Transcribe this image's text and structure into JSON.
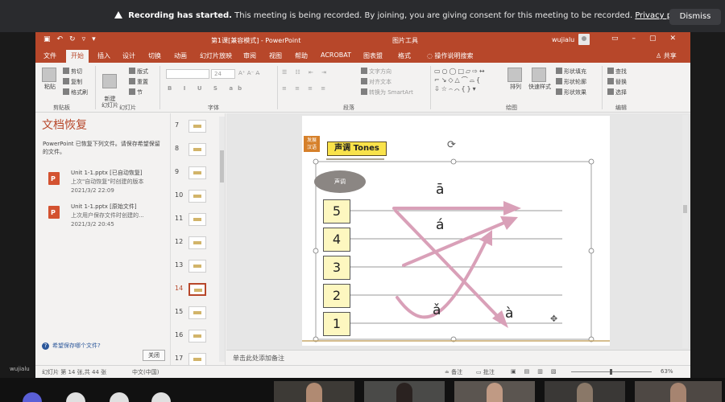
{
  "banner": {
    "title": "Recording has started.",
    "message": "This meeting is being recorded. By joining, you are giving consent for this meeting to be recorded.",
    "link": "Privacy policy",
    "dismiss": "Dismiss"
  },
  "window": {
    "title": "第1课[兼容模式] - PowerPoint",
    "context_tab": "图片工具",
    "user": "wujialu"
  },
  "tabs": [
    {
      "label": "文件"
    },
    {
      "label": "开始"
    },
    {
      "label": "插入"
    },
    {
      "label": "设计"
    },
    {
      "label": "切换"
    },
    {
      "label": "动画"
    },
    {
      "label": "幻灯片放映"
    },
    {
      "label": "审阅"
    },
    {
      "label": "视图"
    },
    {
      "label": "帮助"
    },
    {
      "label": "ACROBAT"
    },
    {
      "label": "图表盟"
    },
    {
      "label": "格式"
    },
    {
      "label": "操作说明搜索"
    },
    {
      "label": "共享"
    }
  ],
  "ribbon": {
    "paste": "粘贴",
    "cut": "剪切",
    "copy": "复制",
    "format_painter": "格式刷",
    "clipboard_group": "剪贴板",
    "new_slide": "新建\n幻灯片",
    "layout": "版式",
    "reset": "重置",
    "section": "节",
    "slides_group": "幻灯片",
    "font_size": "24",
    "font_group": "字体",
    "text_direction": "文字方向",
    "align_text": "对齐文本",
    "smartart": "转换为 SmartArt",
    "paragraph_group": "段落",
    "arrange": "排列",
    "quick_styles": "快速样式",
    "shape_fill": "形状填充",
    "shape_outline": "形状轮廓",
    "shape_effects": "形状效果",
    "drawing_group": "绘图",
    "find": "查找",
    "replace": "替换",
    "select": "选择",
    "editing_group": "编辑"
  },
  "recovery": {
    "title": "文档恢复",
    "description": "PowerPoint 已恢复下列文件。请保存希望保留的文件。",
    "files": [
      {
        "name": "Unit 1-1.pptx [已自动恢复]",
        "note": "上次\"自动恢复\"时创建的版本",
        "time": "2021/3/2 22:09"
      },
      {
        "name": "Unit 1-1.pptx [原始文件]",
        "note": "上次用户保存文件时创建的...",
        "time": "2021/3/2 20:45"
      }
    ],
    "question": "希望保存哪个文件?",
    "close": "关闭"
  },
  "thumbnails": [
    {
      "num": "7"
    },
    {
      "num": "8"
    },
    {
      "num": "9"
    },
    {
      "num": "10"
    },
    {
      "num": "11"
    },
    {
      "num": "12"
    },
    {
      "num": "13"
    },
    {
      "num": "14"
    },
    {
      "num": "15"
    },
    {
      "num": "16"
    },
    {
      "num": "17"
    }
  ],
  "active_slide_number": "14",
  "slide": {
    "badge": "发展\n汉语",
    "heading": "声调 Tones",
    "tag": "声调",
    "levels": [
      "5",
      "4",
      "3",
      "2",
      "1"
    ],
    "tones": {
      "first": "ā",
      "second": "á",
      "third": "ǎ",
      "fourth": "à"
    },
    "arrow_color": "#d9a0b8"
  },
  "notes_placeholder": "单击此处添加备注",
  "status": {
    "slide_info": "幻灯片 第 14 张,共 44 张",
    "language": "中文(中国)",
    "notes": "备注",
    "comments": "批注",
    "zoom": "63%"
  },
  "taskbar_user": "wujialu",
  "colors": {
    "accent": "#b7472a",
    "banner": "#2a2b2e"
  }
}
